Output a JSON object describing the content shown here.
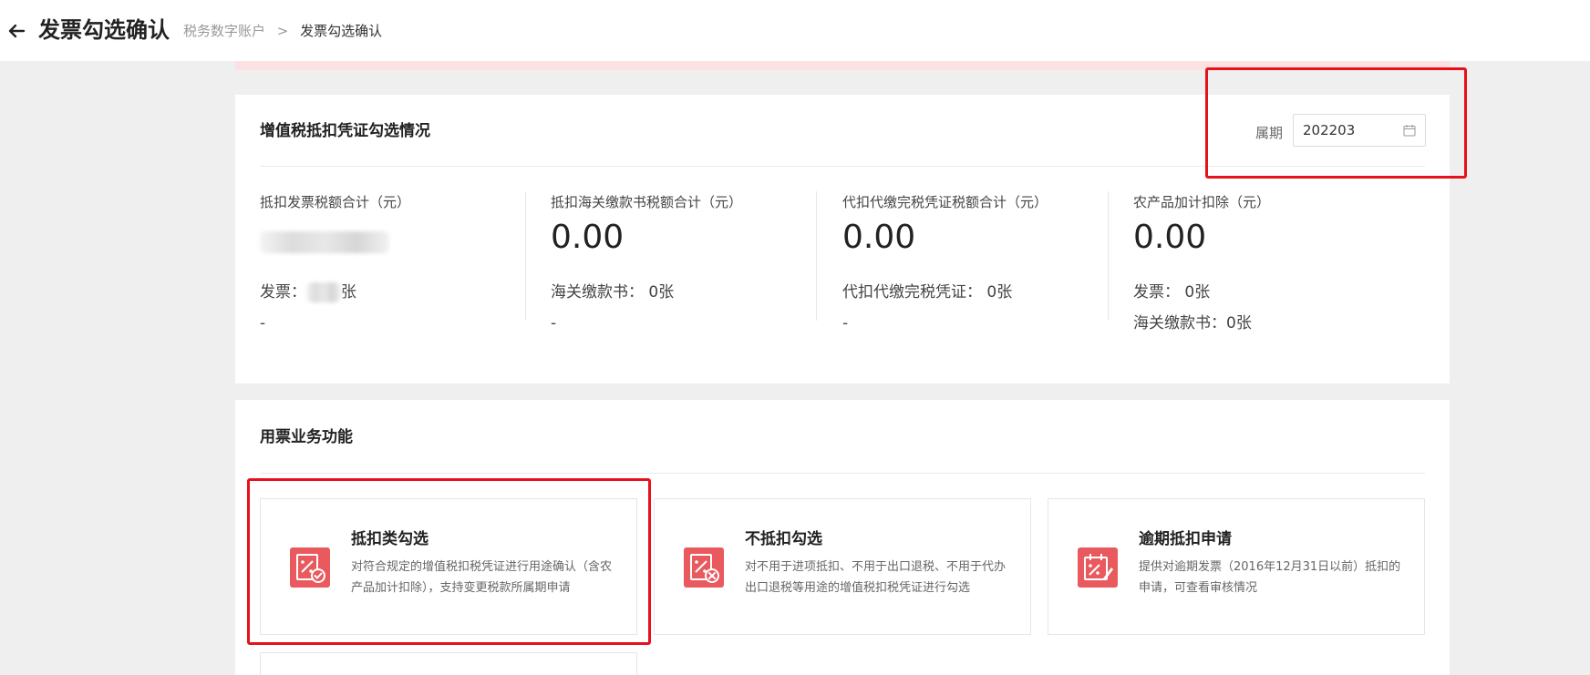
{
  "header": {
    "title": "发票勾选确认",
    "breadcrumb": {
      "parent": "税务数字账户",
      "separator": ">",
      "current": "发票勾选确认"
    }
  },
  "summary": {
    "title": "增值税抵扣凭证勾选情况",
    "period_label": "属期",
    "period_value": "202203",
    "columns": [
      {
        "label": "抵扣发票税额合计（元）",
        "amount": "",
        "detail": "发票：",
        "detail_suffix": "张",
        "detail2": "-"
      },
      {
        "label": "抵扣海关缴款书税额合计（元）",
        "amount": "0.00",
        "detail": "海关缴款书： 0张",
        "detail2": "-"
      },
      {
        "label": "代扣代缴完税凭证税额合计（元）",
        "amount": "0.00",
        "detail": "代扣代缴完税凭证： 0张",
        "detail2": "-"
      },
      {
        "label": "农产品加计扣除（元）",
        "amount": "0.00",
        "detail": "发票： 0张",
        "detail2": "海关缴款书：0张"
      }
    ]
  },
  "functions": {
    "title": "用票业务功能",
    "items": [
      {
        "title": "抵扣类勾选",
        "desc": "对符合规定的增值税扣税凭证进行用途确认（含农产品加计扣除），支持变更税款所属期申请",
        "icon": "deduct-check-icon"
      },
      {
        "title": "不抵扣勾选",
        "desc": "对不用于进项抵扣、不用于出口退税、不用于代办出口退税等用途的增值税扣税凭证进行勾选",
        "icon": "non-deduct-check-icon"
      },
      {
        "title": "逾期抵扣申请",
        "desc": "提供对逾期发票（2016年12月31日以前）抵扣的申请，可查看审核情况",
        "icon": "overdue-apply-icon"
      }
    ]
  },
  "colors": {
    "accent_red": "#e85a5e",
    "highlight_red": "#e8101b",
    "alert_pink": "#fbe1e1"
  }
}
